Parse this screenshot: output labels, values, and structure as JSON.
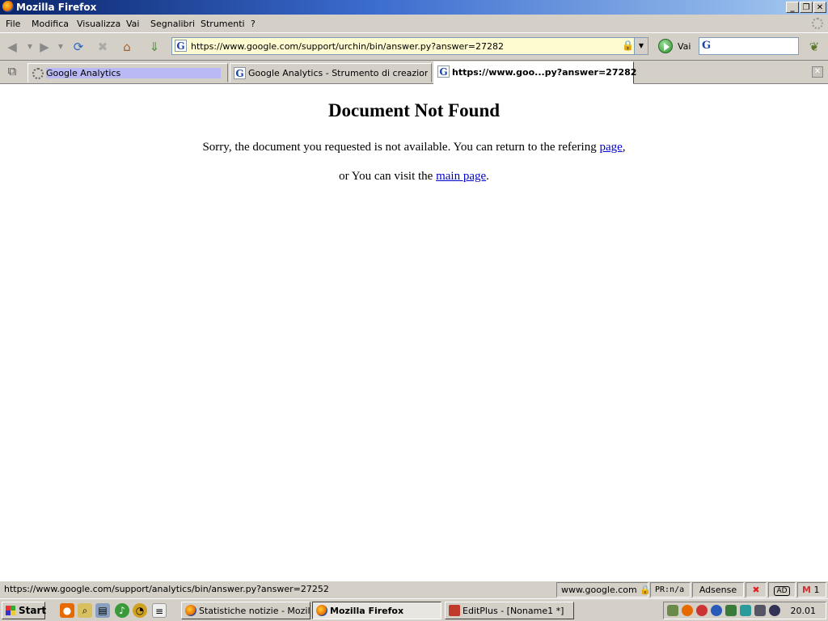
{
  "window": {
    "title": "Mozilla Firefox",
    "controls": [
      "minimize-icon",
      "restore-icon",
      "close-icon"
    ]
  },
  "menu": {
    "items": [
      "File",
      "Modifica",
      "Visualizza",
      "Vai",
      "Segnalibri",
      "Strumenti",
      "?"
    ]
  },
  "toolbar": {
    "buttons": [
      "back-icon",
      "forward-icon",
      "reload-icon",
      "stop-icon",
      "home-icon",
      "download-icon"
    ],
    "url": "https://www.google.com/support/urchin/bin/answer.py?answer=27282",
    "go_label": "Vai"
  },
  "tabs": [
    {
      "label": "Google Analytics",
      "loading": true
    },
    {
      "label": "Google Analytics - Strumento di creazione ...",
      "loading": false
    },
    {
      "label": "https://www.goo...py?answer=27282",
      "active": true
    }
  ],
  "page": {
    "heading": "Document Not Found",
    "line1_text": "Sorry, the document you requested is not available. You can return to the refering ",
    "line1_link": "page",
    "line1_end": ",",
    "line2_text": "or You can visit the ",
    "line2_link": "main page",
    "line2_end": "."
  },
  "statusbar": {
    "status_text": "https://www.google.com/support/analytics/bin/answer.py?answer=27252",
    "domain": "www.google.com",
    "pagerank": "PR:n/a",
    "adsense": "Adsense",
    "ad": "AD",
    "mail_count": "1"
  },
  "taskbar": {
    "start": "Start",
    "buttons": [
      "Statistiche notizie - Mozill...",
      "Mozilla Firefox",
      "EditPlus - [Noname1 *]"
    ],
    "clock": "20.01"
  }
}
